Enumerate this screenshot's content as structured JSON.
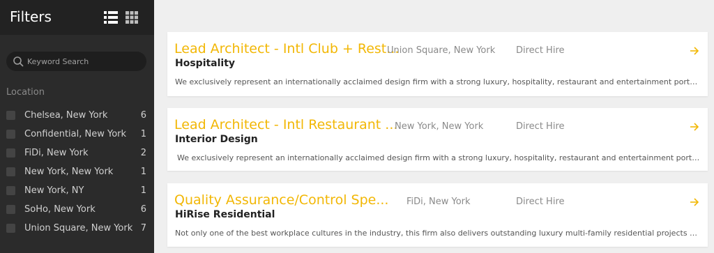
{
  "sidebar": {
    "title": "Filters",
    "view_list_icon": "list-view-icon",
    "view_grid_icon": "grid-view-icon",
    "search": {
      "placeholder": "Keyword Search",
      "value": ""
    },
    "location_heading": "Location",
    "locations": [
      {
        "label": "Chelsea, New York",
        "count": "6"
      },
      {
        "label": "Confidential, New York",
        "count": "1"
      },
      {
        "label": "FiDi, New York",
        "count": "2"
      },
      {
        "label": "New York, New York",
        "count": "1"
      },
      {
        "label": "New York, NY",
        "count": "1"
      },
      {
        "label": "SoHo, New York",
        "count": "6"
      },
      {
        "label": "Union Square, New York",
        "count": "7"
      }
    ]
  },
  "jobs": [
    {
      "title": "Lead Architect - Intl Club + Rest...",
      "category": "Hospitality",
      "location": "Union Square, New York",
      "type": "Direct Hire",
      "description": "We exclusively represent an internationally acclaimed design firm with a strong luxury, hospitality, restaurant and entertainment portfolio th..."
    },
    {
      "title": "Lead Architect - Intl Restaurant ...",
      "category": "Interior Design",
      "location": "New York, New York",
      "type": "Direct Hire",
      "description": "We exclusively represent an internationally acclaimed design firm with a strong luxury, hospitality, restaurant and entertainment portfolio t..."
    },
    {
      "title": "Quality Assurance/Control Spe...",
      "category": "HiRise Residential",
      "location": "FiDi, New York",
      "type": "Direct Hire",
      "description": "Not only one of the best workplace cultures in the industry, this firm also delivers outstanding luxury multi-family residential projects throug..."
    }
  ],
  "colors": {
    "accent": "#f2b705",
    "sidebar_bg": "#2b2b2b",
    "page_bg": "#efefef"
  }
}
